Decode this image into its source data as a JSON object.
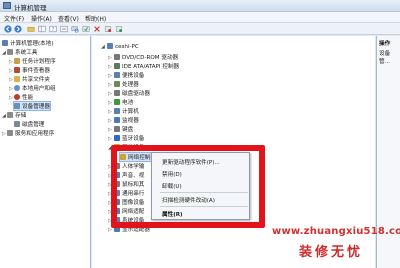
{
  "window": {
    "title": "计算机管理"
  },
  "menu": [
    "文件(F)",
    "操作(A)",
    "查看(V)",
    "帮助(H)"
  ],
  "left_tree": [
    {
      "label": "计算机管理(本地)",
      "indent": 0,
      "exp": "",
      "color": "#5b7fb0"
    },
    {
      "label": "系统工具",
      "indent": 1,
      "exp": "◢",
      "color": "#8a8a8a"
    },
    {
      "label": "任务计划程序",
      "indent": 2,
      "exp": "▷",
      "color": "#c8a04a"
    },
    {
      "label": "事件查看器",
      "indent": 2,
      "exp": "▷",
      "color": "#b24a3a"
    },
    {
      "label": "共享文件夹",
      "indent": 2,
      "exp": "▷",
      "color": "#d9b44a"
    },
    {
      "label": "本地用户和组",
      "indent": 2,
      "exp": "▷",
      "color": "#6a8fbf"
    },
    {
      "label": "性能",
      "indent": 2,
      "exp": "▷",
      "color": "#c0392b"
    },
    {
      "label": "设备管理器",
      "indent": 2,
      "exp": "",
      "color": "#6d8db5",
      "selected": true
    },
    {
      "label": "存储",
      "indent": 1,
      "exp": "◢",
      "color": "#8a8a8a"
    },
    {
      "label": "磁盘管理",
      "indent": 2,
      "exp": "",
      "color": "#7a8a9a"
    },
    {
      "label": "服务和应用程序",
      "indent": 1,
      "exp": "▷",
      "color": "#8a8a8a"
    }
  ],
  "device_tree": [
    {
      "label": "ceshi-PC",
      "indent": 0,
      "exp": "◢",
      "color": "#5b7fb0"
    },
    {
      "label": "DVD/CD-ROM 驱动器",
      "indent": 1,
      "exp": "▷",
      "color": "#777777"
    },
    {
      "label": "IDE ATA/ATAPI 控制器",
      "indent": 1,
      "exp": "▷",
      "color": "#5a7a5a"
    },
    {
      "label": "便携设备",
      "indent": 1,
      "exp": "▷",
      "color": "#5b7fb0"
    },
    {
      "label": "处理器",
      "indent": 1,
      "exp": "▷",
      "color": "#6a8a5a"
    },
    {
      "label": "磁盘驱动器",
      "indent": 1,
      "exp": "▷",
      "color": "#777777"
    },
    {
      "label": "电池",
      "indent": 1,
      "exp": "▷",
      "color": "#3a9a3a"
    },
    {
      "label": "计算机",
      "indent": 1,
      "exp": "▷",
      "color": "#5b7fb0"
    },
    {
      "label": "监视器",
      "indent": 1,
      "exp": "▷",
      "color": "#4a7ab0"
    },
    {
      "label": "键盘",
      "indent": 1,
      "exp": "▷",
      "color": "#777777"
    },
    {
      "label": "蓝牙设备",
      "indent": 1,
      "exp": "▷",
      "color": "#2a6ad0"
    },
    {
      "label": "其他设备",
      "indent": 1,
      "exp": "◢",
      "color": "#d0a030"
    },
    {
      "label": "网络控制器",
      "indent": 2,
      "exp": "",
      "color": "#d0a030",
      "highlight": true
    },
    {
      "label": "人体学输",
      "indent": 1,
      "exp": "▷",
      "color": "#777777"
    },
    {
      "label": "声音、视",
      "indent": 1,
      "exp": "▷",
      "color": "#4a7ab0"
    },
    {
      "label": "鼠标和其",
      "indent": 1,
      "exp": "▷",
      "color": "#777777"
    },
    {
      "label": "通用串行",
      "indent": 1,
      "exp": "▷",
      "color": "#5b7fb0"
    },
    {
      "label": "图像设备",
      "indent": 1,
      "exp": "▷",
      "color": "#4a7ab0"
    },
    {
      "label": "网络适配",
      "indent": 1,
      "exp": "▷",
      "color": "#4a7ab0"
    },
    {
      "label": "系统设备",
      "indent": 1,
      "exp": "▷",
      "color": "#5b7fb0"
    },
    {
      "label": "显示适配器",
      "indent": 1,
      "exp": "▷",
      "color": "#4a7ab0"
    }
  ],
  "context_menu": {
    "update": "更新驱动程序软件(P)...",
    "disable": "禁用(D)",
    "uninstall": "卸载(U)",
    "scan": "扫描检测硬件改动(A)",
    "properties": "属性(R)"
  },
  "action_pane": {
    "header": "操作",
    "subheader": "设备管..."
  },
  "watermark": {
    "url": "www.zhuangxiu518.com",
    "brand": "装修无忧"
  },
  "colors": {
    "highlight_box": "#e2131b",
    "watermark": "#d23030",
    "selection": "#cfe3fa"
  }
}
